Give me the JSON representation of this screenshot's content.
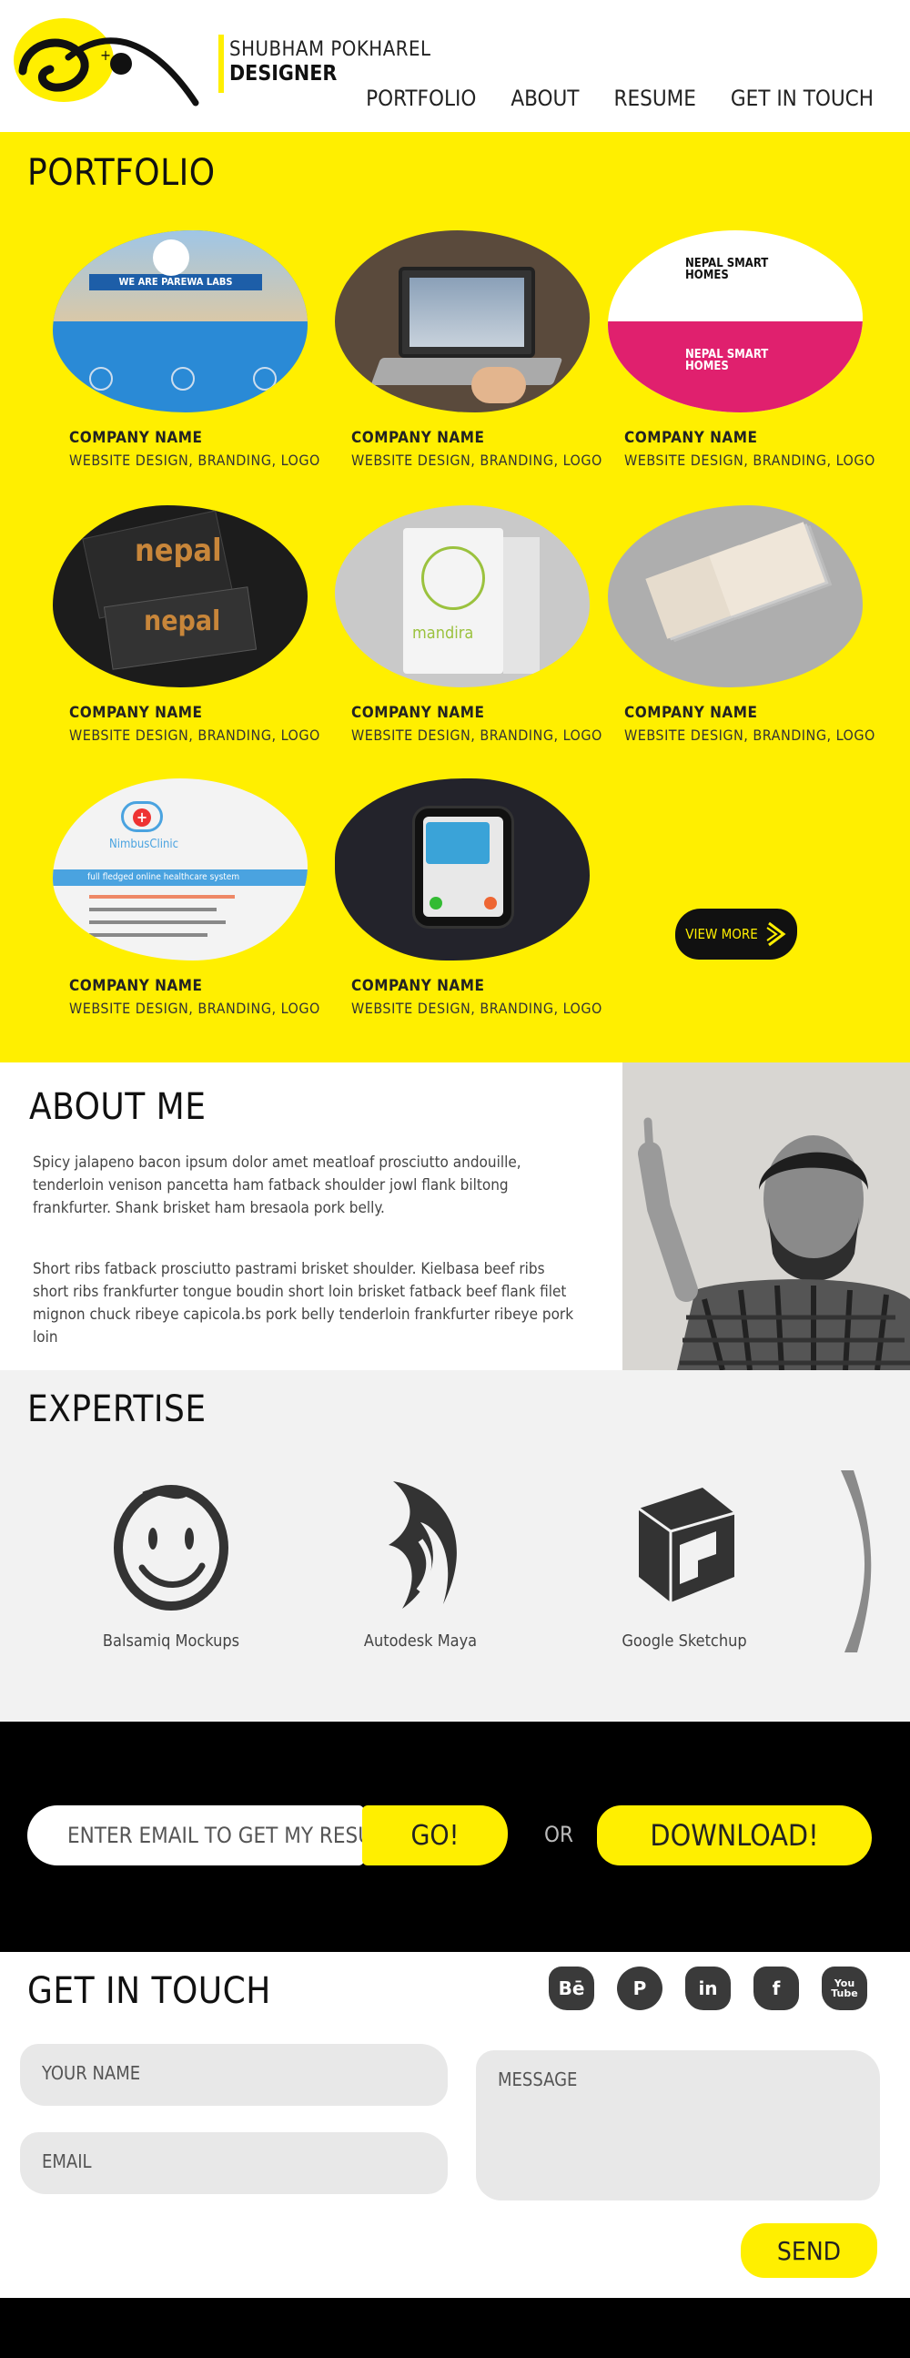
{
  "header": {
    "name": "SHUBHAM POKHAREL",
    "role": "DESIGNER",
    "nav": [
      "PORTFOLIO",
      "ABOUT",
      "RESUME",
      "GET IN TOUCH"
    ]
  },
  "portfolio": {
    "title": "PORTFOLIO",
    "cards": [
      {
        "name": "COMPANY NAME",
        "tags": "WEBSITE DESIGN, BRANDING, LOGO",
        "image_text": "WE ARE PAREWA LABS"
      },
      {
        "name": "COMPANY NAME",
        "tags": "WEBSITE DESIGN, BRANDING, LOGO"
      },
      {
        "name": "COMPANY NAME",
        "tags": "WEBSITE DESIGN, BRANDING, LOGO",
        "image_text": "NEPAL SMART HOMES"
      },
      {
        "name": "COMPANY NAME",
        "tags": "WEBSITE DESIGN, BRANDING, LOGO",
        "image_text": "nepal"
      },
      {
        "name": "COMPANY NAME",
        "tags": "WEBSITE DESIGN, BRANDING, LOGO",
        "image_text": "mandira"
      },
      {
        "name": "COMPANY NAME",
        "tags": "WEBSITE DESIGN, BRANDING, LOGO"
      },
      {
        "name": "COMPANY NAME",
        "tags": "WEBSITE DESIGN, BRANDING, LOGO",
        "image_text": "NimbusClinic",
        "image_sub": "full fledged online healthcare system"
      },
      {
        "name": "COMPANY NAME",
        "tags": "WEBSITE DESIGN, BRANDING, LOGO"
      }
    ],
    "view_more": "VIEW MORE"
  },
  "about": {
    "title": "ABOUT ME",
    "p1": "Spicy jalapeno bacon ipsum dolor amet meatloaf prosciutto andouille, tenderloin venison pancetta ham fatback shoulder jowl flank biltong frankfurter. Shank brisket ham bresaola pork belly.",
    "p2": "Short ribs fatback prosciutto pastrami brisket shoulder. Kielbasa beef ribs short ribs frankfurter tongue boudin short loin brisket fatback beef flank filet mignon chuck ribeye capicola.bs pork belly tenderloin frankfurter ribeye pork loin"
  },
  "expertise": {
    "title": "EXPERTISE",
    "skills": [
      "Balsamiq Mockups",
      "Autodesk Maya",
      "Google Sketchup"
    ]
  },
  "cta": {
    "input_placeholder": "ENTER EMAIL TO GET MY RESUME",
    "go": "GO!",
    "or": "OR",
    "download": "DOWNLOAD!"
  },
  "contact": {
    "title": "GET IN TOUCH",
    "socials": [
      "Bē",
      "P",
      "in",
      "f",
      "You Tube"
    ],
    "name_placeholder": "YOUR NAME",
    "email_placeholder": "EMAIL",
    "message_placeholder": "MESSAGE",
    "send": "SEND"
  },
  "colors": {
    "accent": "#ffef00",
    "dark": "#111111",
    "panel": "#f2f2f2"
  }
}
